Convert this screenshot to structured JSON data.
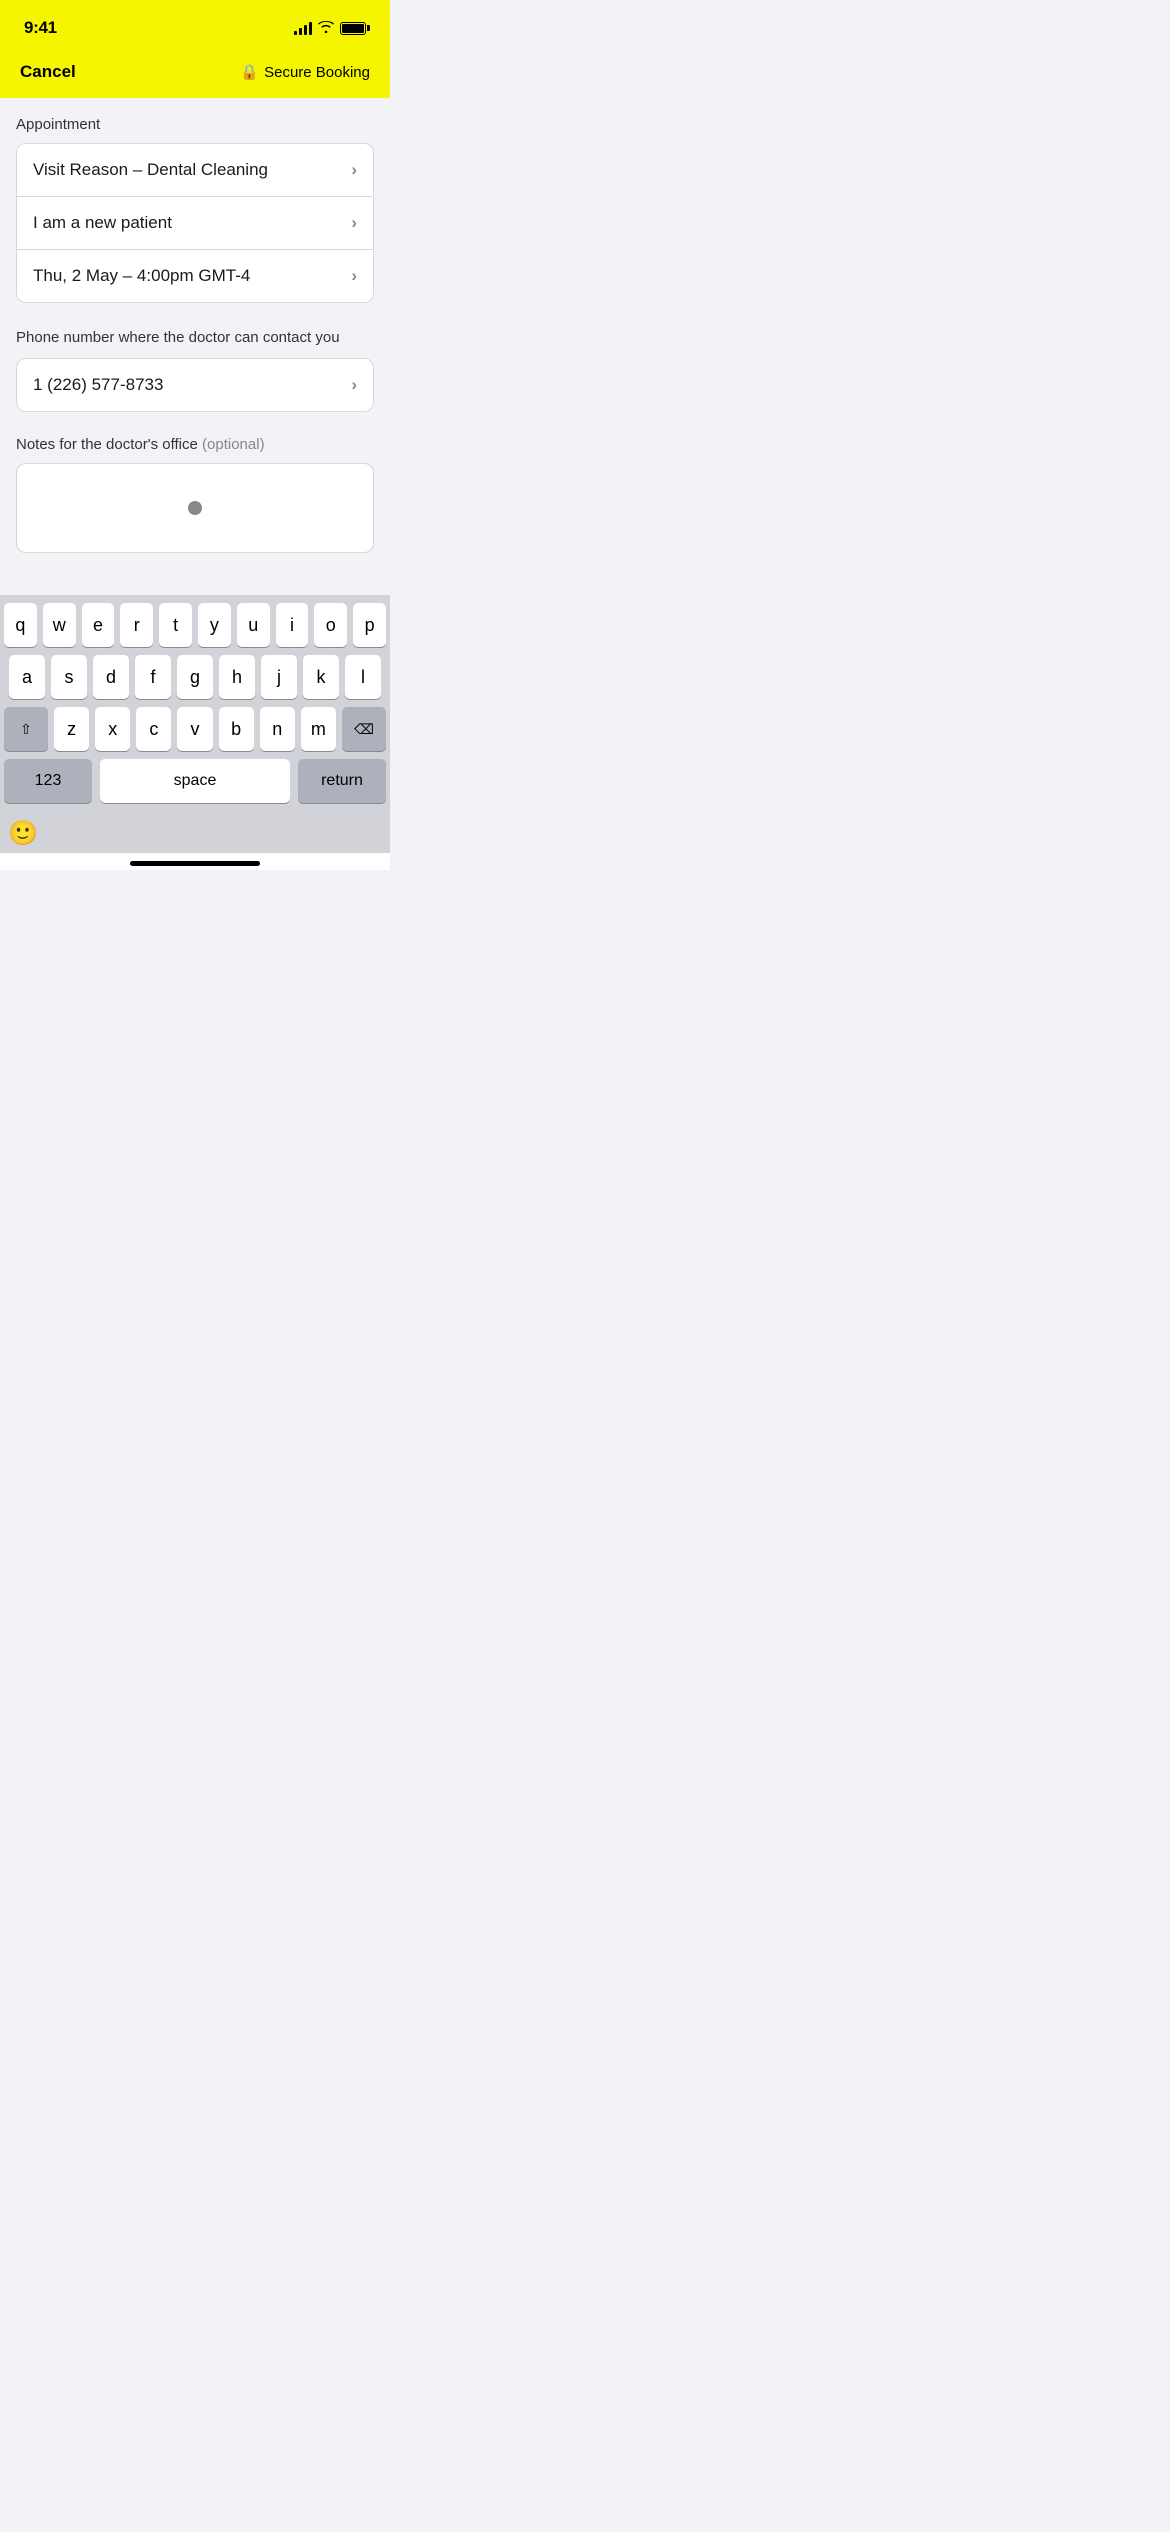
{
  "statusBar": {
    "time": "9:41"
  },
  "navBar": {
    "cancelLabel": "Cancel",
    "secureLabel": "Secure Booking",
    "lockSymbol": "🔒"
  },
  "appointment": {
    "sectionLabel": "Appointment",
    "items": [
      {
        "label": "Visit Reason – Dental Cleaning"
      },
      {
        "label": "I am a new patient"
      },
      {
        "label": "Thu, 2 May – 4:00pm GMT-4"
      }
    ]
  },
  "phone": {
    "label": "Phone number where the doctor can contact you",
    "value": "1 (226) 577-8733"
  },
  "notes": {
    "label": "Notes for the doctor's office",
    "optionalLabel": "(optional)"
  },
  "keyboard": {
    "row1": [
      "q",
      "w",
      "e",
      "r",
      "t",
      "y",
      "u",
      "i",
      "o",
      "p"
    ],
    "row2": [
      "a",
      "s",
      "d",
      "f",
      "g",
      "h",
      "j",
      "k",
      "l"
    ],
    "row3": [
      "z",
      "x",
      "c",
      "v",
      "b",
      "n",
      "m"
    ],
    "numberLabel": "123",
    "spaceLabel": "space",
    "returnLabel": "return"
  }
}
